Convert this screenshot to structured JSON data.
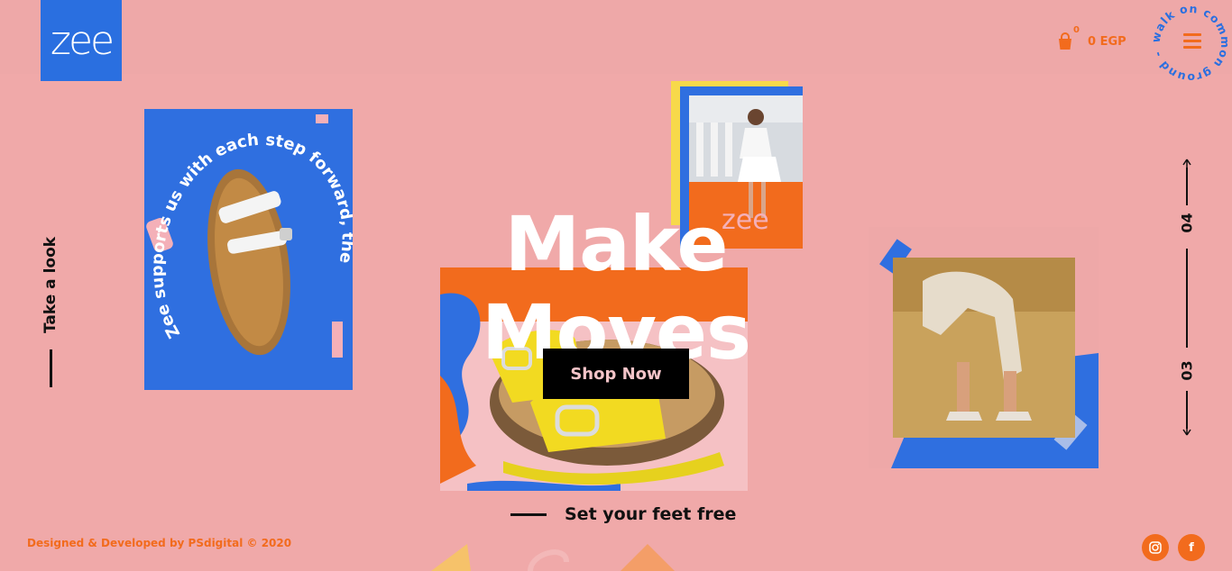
{
  "header": {
    "logo_text": "zee",
    "cart_count": "0",
    "cart_total": "0 EGP",
    "ring_text": "walk on common ground -"
  },
  "side_left": {
    "label": "Take a look"
  },
  "side_right": {
    "page_top": "04",
    "page_bottom": "03"
  },
  "hero": {
    "headline": "Make Moves",
    "cta": "Shop Now",
    "tagline": "Set your feet free"
  },
  "card_a": {
    "curve_text": "Zee supports us with each step forward, the"
  },
  "card_b": {
    "logo_text": "zee"
  },
  "footer": {
    "credit": "Designed & Developed by PSdigital © 2020"
  },
  "social": [
    {
      "icon": "instagram-icon",
      "glyph": "◎"
    },
    {
      "icon": "facebook-icon",
      "glyph": "f"
    }
  ],
  "colors": {
    "background": "#f0a9a9",
    "accent": "#f26b1d",
    "blue": "#2f6fe0",
    "yellow": "#f7d94a"
  }
}
